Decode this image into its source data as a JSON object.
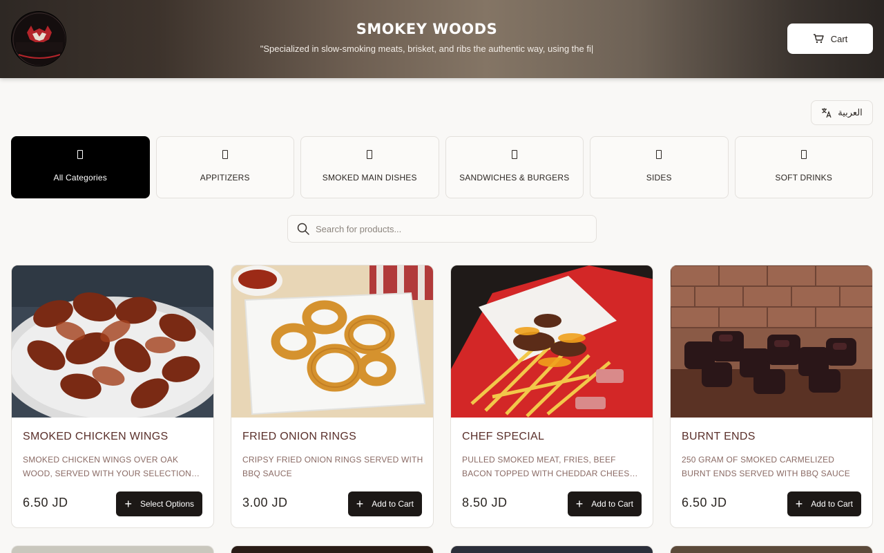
{
  "brand": {
    "title": "SMOKEY WOODS",
    "tagline": "\"Specialized in slow-smoking meats, brisket, and ribs the authentic way, using the fi|",
    "logo_text": "SMOKEY WOODS"
  },
  "header": {
    "cart_label": "Cart",
    "cart_icon": "cart-icon"
  },
  "language": {
    "label": "العربية",
    "icon": "translate-icon"
  },
  "categories": [
    {
      "label": "All Categories",
      "active": true
    },
    {
      "label": "APPITIZERS",
      "active": false
    },
    {
      "label": "SMOKED MAIN DISHES",
      "active": false
    },
    {
      "label": "SANDWICHES & BURGERS",
      "active": false
    },
    {
      "label": "SIDES",
      "active": false
    },
    {
      "label": "SOFT DRINKS",
      "active": false
    }
  ],
  "search": {
    "placeholder": "Search for products..."
  },
  "products": [
    {
      "name": "SMOKED CHICKEN WINGS",
      "description": "SMOKED CHICKEN WINGS OVER OAK WOOD, SERVED WITH YOUR SELECTION OF SPICY SAUCE",
      "price": "6.50 JD",
      "button": "Select Options"
    },
    {
      "name": "FRIED ONION RINGS",
      "description": "CRIPSY FRIED ONION RINGS SERVED WITH BBQ SAUCE",
      "price": "3.00 JD",
      "button": "Add to Cart"
    },
    {
      "name": "CHEF SPECIAL",
      "description": "PULLED SMOKED MEAT, FRIES, BEEF BACON TOPPED WITH CHEDDAR CHEESE AND BBQ SAUCE",
      "price": "8.50 JD",
      "button": "Add to Cart"
    },
    {
      "name": "BURNT ENDS",
      "description": "250 GRAM OF SMOKED CARMELIZED BURNT ENDS SERVED WITH BBQ SAUCE",
      "price": "6.50 JD",
      "button": "Add to Cart"
    }
  ],
  "colors": {
    "accent": "#1c1816",
    "active_category": "#000000",
    "product_name": "#5a2f2a",
    "background": "#f9f8f6"
  }
}
